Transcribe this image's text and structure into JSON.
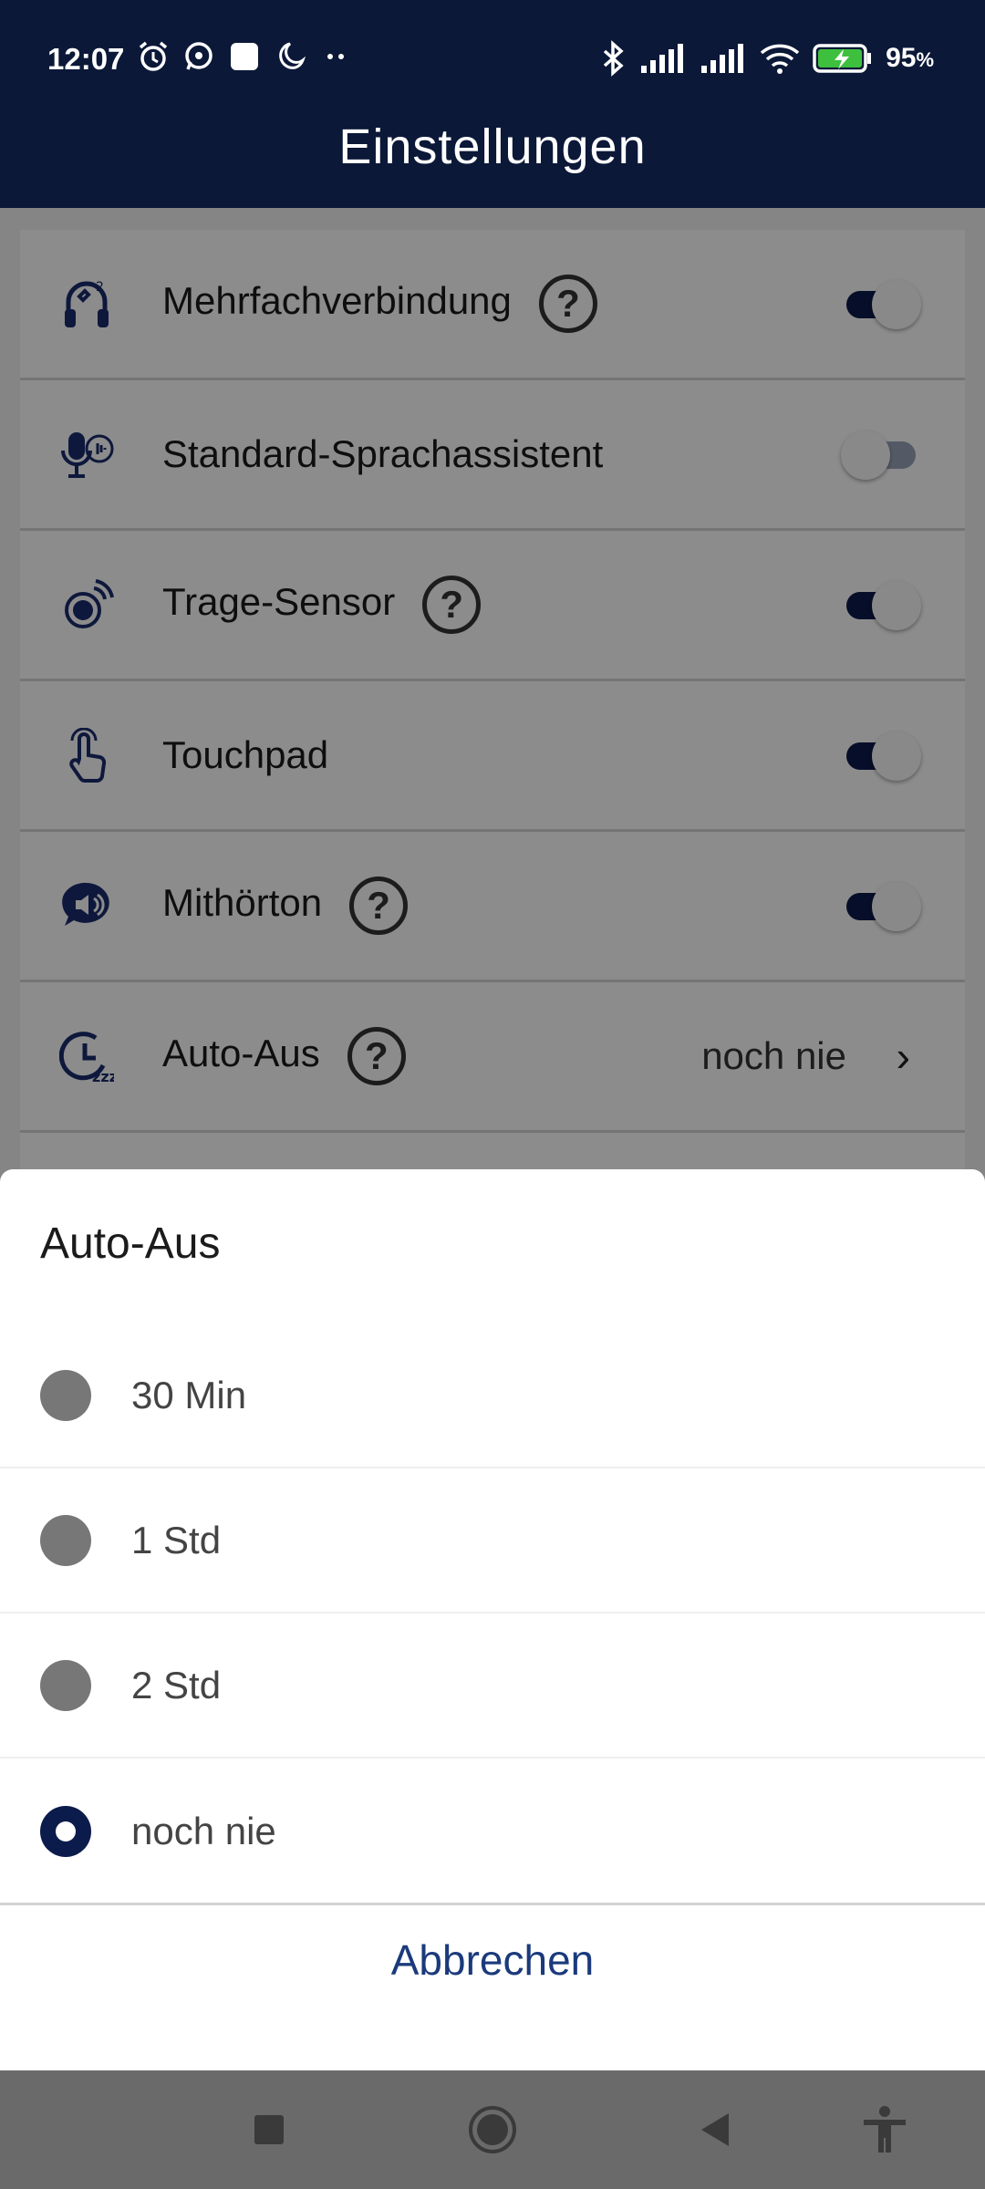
{
  "status_bar": {
    "time": "12:07",
    "battery_percent": "95",
    "battery_suffix": "%"
  },
  "header": {
    "title": "Einstellungen"
  },
  "settings": [
    {
      "label": "Mehrfachverbindung",
      "icon": "multipoint-headphones-icon",
      "help": "?",
      "toggle": true
    },
    {
      "label": "Standard-Sprachassistent",
      "icon": "voice-assistant-icon",
      "toggle": false
    },
    {
      "label": "Trage-Sensor",
      "icon": "wear-sensor-icon",
      "help": "?",
      "toggle": true
    },
    {
      "label": "Touchpad",
      "icon": "touch-hand-icon",
      "toggle": true
    },
    {
      "label": "Mithörton",
      "icon": "sidetone-speaker-icon",
      "help": "?",
      "toggle": true
    },
    {
      "label": "Auto-Aus",
      "icon": "sleep-timer-icon",
      "help": "?",
      "value": "noch nie"
    }
  ],
  "sheet": {
    "title": "Auto-Aus",
    "options": [
      {
        "label": "30 Min",
        "selected": false
      },
      {
        "label": "1 Std",
        "selected": false
      },
      {
        "label": "2 Std",
        "selected": false
      },
      {
        "label": "noch nie",
        "selected": true
      }
    ],
    "cancel_label": "Abbrechen"
  },
  "colors": {
    "header_bg": "#0b1838",
    "accent": "#0b1b4b",
    "cancel_text": "#1b3a7c"
  }
}
